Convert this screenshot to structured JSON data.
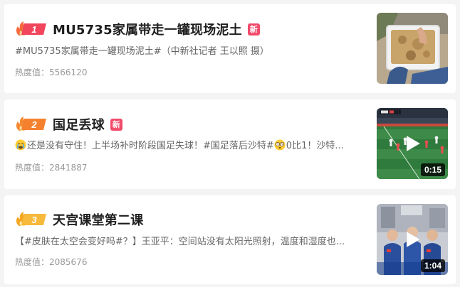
{
  "items": [
    {
      "rank": "1",
      "title": "MU5735家属带走一罐现场泥土",
      "badge": "新",
      "summary": "#MU5735家属带走一罐现场泥土#（中新社记者 王以照 摄）",
      "heat_label": "热度值：",
      "heat_value": "5566120",
      "thumbnail": "photo-soil-in-basket",
      "has_video": false
    },
    {
      "rank": "2",
      "title": "国足丢球",
      "badge": "新",
      "summary_pre": "还是没有守住！上半场补时阶段国足失球！#国足落后沙特#",
      "summary_post": "0比1！沙特...",
      "heat_label": "热度值：",
      "heat_value": "2841887",
      "thumbnail": "video-football-match",
      "has_video": true,
      "duration": "0:15"
    },
    {
      "rank": "3",
      "title": "天宫课堂第二课",
      "summary": "【#皮肤在太空会变好吗#？】王亚平：空间站没有太阳光照射，温度和湿度也...",
      "heat_label": "热度值：",
      "heat_value": "2085676",
      "thumbnail": "video-astronauts-class",
      "has_video": true,
      "duration": "1:04"
    }
  ],
  "colors": {
    "rank1": "#f0455b",
    "rank2": "#f5812e",
    "rank3": "#f6b93b",
    "new_badge": "#f04b6a",
    "title": "#1f1f1f",
    "summary": "#666666",
    "heat": "#999999"
  }
}
